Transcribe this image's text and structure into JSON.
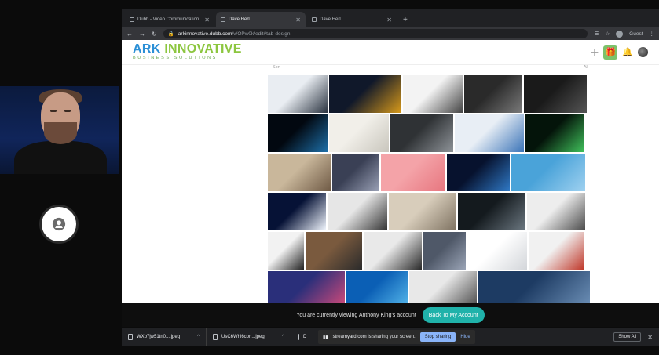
{
  "browser": {
    "tabs": [
      {
        "label": "Dubb - Video Communication",
        "active": false
      },
      {
        "label": "Dave Herl",
        "active": true
      },
      {
        "label": "Dave Herl",
        "active": false
      }
    ],
    "new_tab_label": "+",
    "url_host": "arkinnovative.dubb.com",
    "url_path": "/v/OPw0k/edit#tab-design",
    "profile_label": "Guest"
  },
  "site": {
    "logo_main_a": "ARK ",
    "logo_main_b": "INNOVATIVE",
    "logo_sub": "BUSINESS SOLUTIONS",
    "sort_left": "Sort",
    "sort_right": "All"
  },
  "gallery": {
    "tiles": [
      {
        "c1": "#e9edf2",
        "c2": "#2a3340"
      },
      {
        "c1": "#10182a",
        "c2": "#d89a1a"
      },
      {
        "c1": "#f3f3f3",
        "c2": "#444"
      },
      {
        "c1": "#2a2a2a",
        "c2": "#7a7a7a"
      },
      {
        "c1": "#1a1a1a",
        "c2": "#555"
      },
      {
        "c1": "#020810",
        "c2": "#1d6fa8"
      },
      {
        "c1": "#f1efe9",
        "c2": "#c9c6bd"
      },
      {
        "c1": "#2f3235",
        "c2": "#8e9398"
      },
      {
        "c1": "#e8eef5",
        "c2": "#3b74b8"
      },
      {
        "c1": "#04140a",
        "c2": "#3fbf5a"
      },
      {
        "c1": "#c9b79b",
        "c2": "#6f5a45"
      },
      {
        "c1": "#3a4055",
        "c2": "#9aa1b6"
      },
      {
        "c1": "#f4a3a8",
        "c2": "#e7767f"
      },
      {
        "c1": "#07122e",
        "c2": "#2f79c6"
      },
      {
        "c1": "#4aa3d9",
        "c2": "#9fd1f0"
      },
      {
        "c1": "#061236",
        "c2": "#f2f7ff"
      },
      {
        "c1": "#e6e6e6",
        "c2": "#333"
      },
      {
        "c1": "#d8cdbb",
        "c2": "#7e7261"
      },
      {
        "c1": "#141a1e",
        "c2": "#6b7780"
      },
      {
        "c1": "#ededed",
        "c2": "#4a4a4a"
      },
      {
        "c1": "#f2f2f2",
        "c2": "#222"
      },
      {
        "c1": "#7a5a3e",
        "c2": "#2b2b2b"
      },
      {
        "c1": "#e9e9e9",
        "c2": "#2a2a2a"
      },
      {
        "c1": "#4f5868",
        "c2": "#9aa4b6"
      },
      {
        "c1": "#ffffff",
        "c2": "#d3d6da"
      },
      {
        "c1": "#f1f1f1",
        "c2": "#c0392b"
      },
      {
        "c1": "#2a2f7a",
        "c2": "#d04a7a"
      },
      {
        "c1": "#0b5fb5",
        "c2": "#54b6ea"
      },
      {
        "c1": "#e8e8e8",
        "c2": "#4c4c4c"
      },
      {
        "c1": "#1d3b63",
        "c2": "#6c8fb6"
      }
    ]
  },
  "overlay": {
    "message": "You are currently viewing Anthony King's account",
    "button": "Back To My Account"
  },
  "downloads": {
    "items": [
      "WXb7jw51tn0....jpeg",
      "UsC6Whl6cor....jpeg",
      "D"
    ],
    "share_message": "streamyard.com is sharing your screen.",
    "stop_label": "Stop sharing",
    "hide_label": "Hide",
    "show_all": "Show All"
  }
}
